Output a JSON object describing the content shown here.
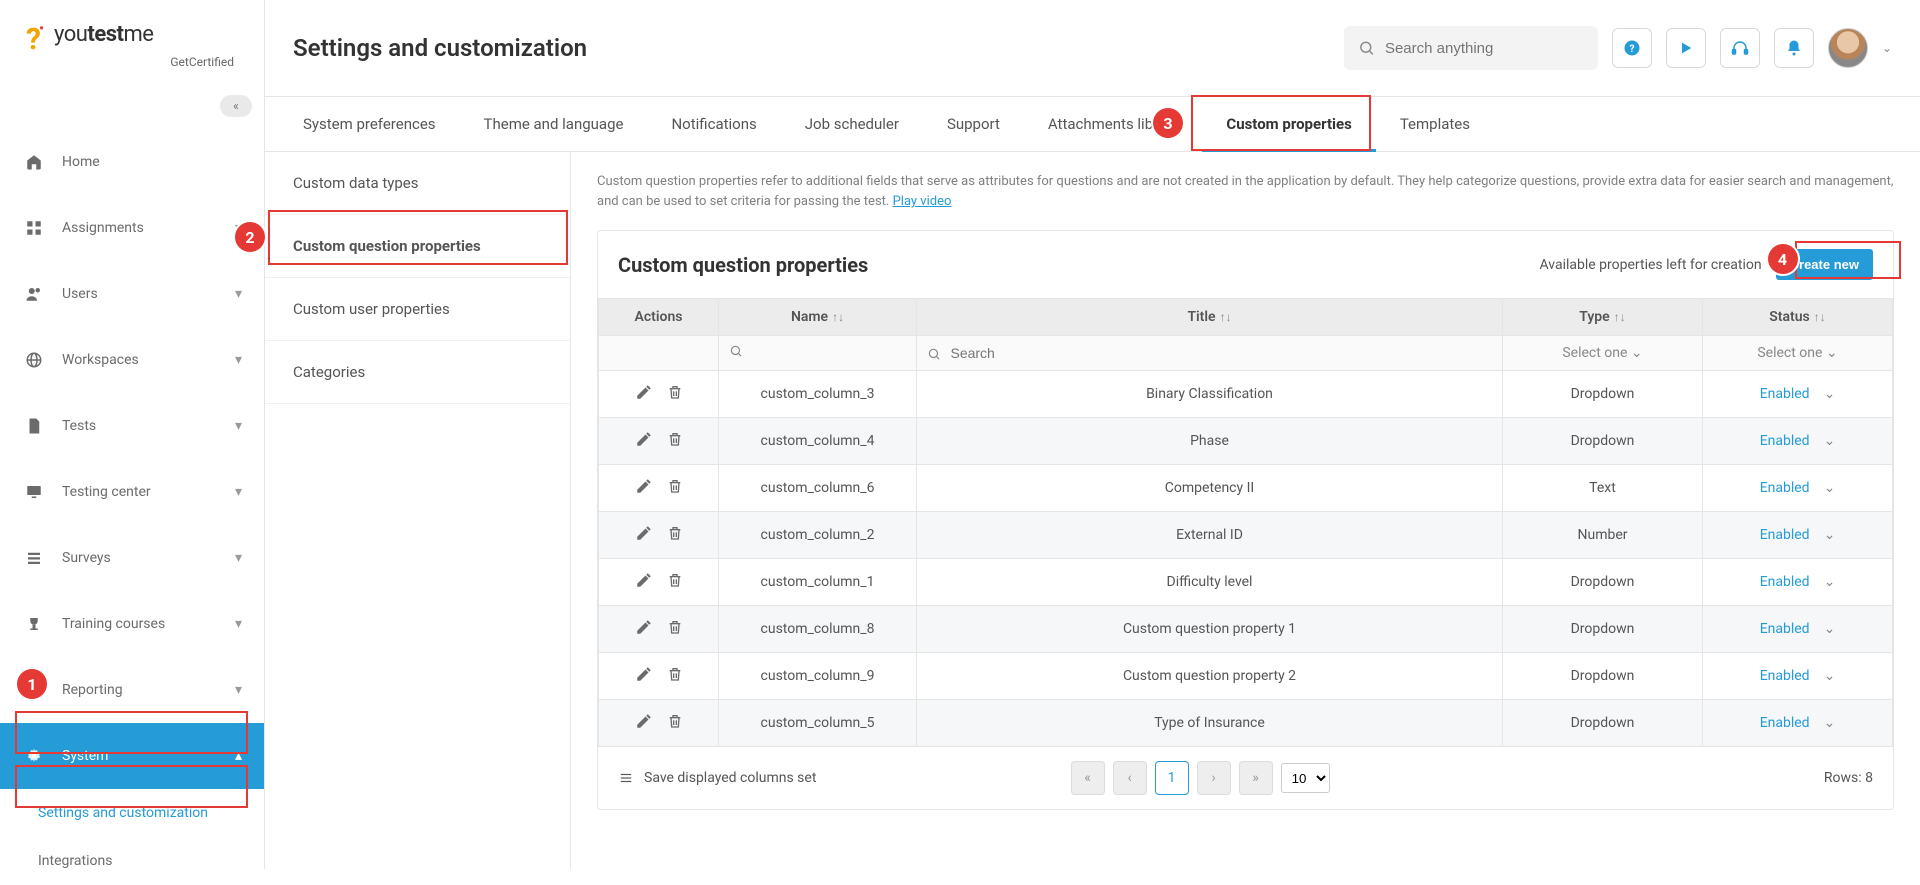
{
  "logo": {
    "brand_pre": "you",
    "brand_mid": "test",
    "brand_post": "me",
    "sub": "GetCertified"
  },
  "sidebar": {
    "items": [
      {
        "label": "Home",
        "icon": "home"
      },
      {
        "label": "Assignments",
        "icon": "grid",
        "chev": true
      },
      {
        "label": "Users",
        "icon": "users",
        "chev": true
      },
      {
        "label": "Workspaces",
        "icon": "globe",
        "chev": true
      },
      {
        "label": "Tests",
        "icon": "file",
        "chev": true
      },
      {
        "label": "Testing center",
        "icon": "monitor",
        "chev": true
      },
      {
        "label": "Surveys",
        "icon": "list",
        "chev": true
      },
      {
        "label": "Training courses",
        "icon": "trophy",
        "chev": true
      },
      {
        "label": "Reporting",
        "icon": "check",
        "chev": true
      },
      {
        "label": "System",
        "icon": "gear",
        "chev_up": true
      }
    ],
    "sub_settings": "Settings and customization",
    "sub_integrations": "Integrations"
  },
  "header": {
    "title": "Settings and customization",
    "search_placeholder": "Search anything"
  },
  "tabs": [
    "System preferences",
    "Theme and language",
    "Notifications",
    "Job scheduler",
    "Support",
    "Attachments library",
    "Custom properties",
    "Templates"
  ],
  "subnav": [
    "Custom data types",
    "Custom question properties",
    "Custom user properties",
    "Categories"
  ],
  "content": {
    "desc": "Custom question properties refer to additional fields that serve as attributes for questions and are not created in the application by default. They help categorize questions, provide extra data for easier search and management, and can be used to set criteria for passing the test.",
    "play_video": "Play video",
    "panel_title": "Custom question properties",
    "available_text": "Available properties left for creation",
    "create_btn": "Create new",
    "columns": {
      "actions": "Actions",
      "name": "Name",
      "title": "Title",
      "type": "Type",
      "status": "Status"
    },
    "filter": {
      "title_placeholder": "Search",
      "select_one": "Select one"
    },
    "rows": [
      {
        "name": "custom_column_3",
        "title": "Binary Classification",
        "type": "Dropdown",
        "status": "Enabled"
      },
      {
        "name": "custom_column_4",
        "title": "Phase",
        "type": "Dropdown",
        "status": "Enabled"
      },
      {
        "name": "custom_column_6",
        "title": "Competency II",
        "type": "Text",
        "status": "Enabled"
      },
      {
        "name": "custom_column_2",
        "title": "External ID",
        "type": "Number",
        "status": "Enabled"
      },
      {
        "name": "custom_column_1",
        "title": "Difficulty level",
        "type": "Dropdown",
        "status": "Enabled"
      },
      {
        "name": "custom_column_8",
        "title": "Custom question property 1",
        "type": "Dropdown",
        "status": "Enabled"
      },
      {
        "name": "custom_column_9",
        "title": "Custom question property 2",
        "type": "Dropdown",
        "status": "Enabled"
      },
      {
        "name": "custom_column_5",
        "title": "Type of Insurance",
        "type": "Dropdown",
        "status": "Enabled"
      }
    ],
    "save_cols": "Save displayed columns set",
    "page_current": "1",
    "page_size": "10",
    "rows_label": "Rows: 8"
  },
  "markers": {
    "m1": "1",
    "m2": "2",
    "m3": "3",
    "m4": "4"
  }
}
